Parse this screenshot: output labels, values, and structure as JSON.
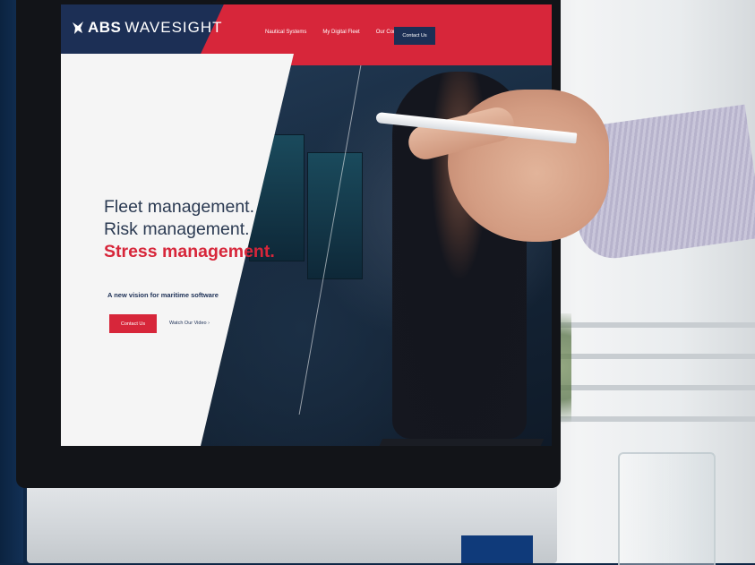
{
  "site": {
    "logo": {
      "brand": "ABS",
      "product": "WAVESIGHT",
      "icon": "abs-eagle-icon"
    },
    "nav": {
      "links": [
        "Nautical Systems",
        "My Digital Fleet",
        "Our Company"
      ],
      "contact_label": "Contact Us"
    },
    "hero": {
      "line1": "Fleet management.",
      "line2": "Risk management.",
      "line3": "Stress management.",
      "tagline": "A new vision for maritime software",
      "contact_label": "Contact Us",
      "watch_label": "Watch Our Video ›"
    }
  },
  "colors": {
    "brand_navy": "#1c2f55",
    "brand_red": "#d7263a"
  }
}
